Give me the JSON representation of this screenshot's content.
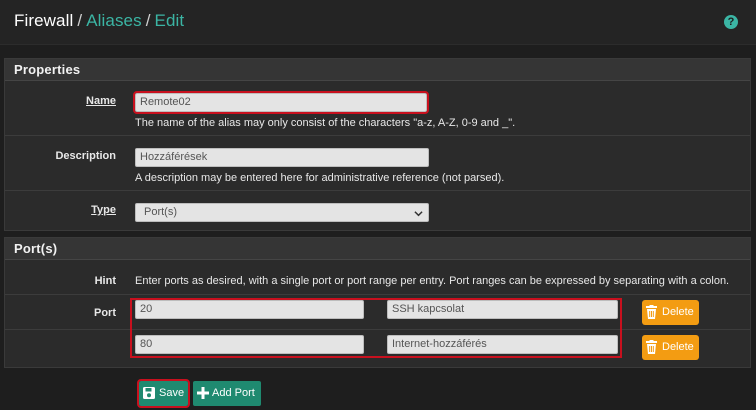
{
  "breadcrumb": {
    "first": "Firewall",
    "second": "Aliases",
    "third": "Edit",
    "separator": "/"
  },
  "help_icon_glyph": "?",
  "properties": {
    "heading": "Properties",
    "name": {
      "label": "Name",
      "value": "Remote02",
      "help": "The name of the alias may only consist of the characters \"a-z, A-Z, 0-9 and _\"."
    },
    "description": {
      "label": "Description",
      "value": "Hozzáférések",
      "help": "A description may be entered here for administrative reference (not parsed)."
    },
    "type": {
      "label": "Type",
      "selected": "Port(s)"
    }
  },
  "ports": {
    "heading": "Port(s)",
    "hint_label": "Hint",
    "hint_text": "Enter ports as desired, with a single port or port range per entry. Port ranges can be expressed by separating with a colon.",
    "port_label": "Port",
    "entries": [
      {
        "port": "20",
        "description": "SSH kapcsolat",
        "delete_label": "Delete"
      },
      {
        "port": "80",
        "description": "Internet-hozzáférés",
        "delete_label": "Delete"
      }
    ]
  },
  "actions": {
    "save_label": "Save",
    "add_port_label": "Add Port"
  },
  "colors": {
    "accent": "#3bb5a4",
    "button": "#1f8a70",
    "delete": "#f39c12",
    "highlight": "#c8101e"
  },
  "icons": {
    "help": "question-circle-icon",
    "save": "floppy-disk-icon",
    "add": "plus-icon",
    "delete": "trash-icon",
    "select": "chevron-down-icon"
  }
}
